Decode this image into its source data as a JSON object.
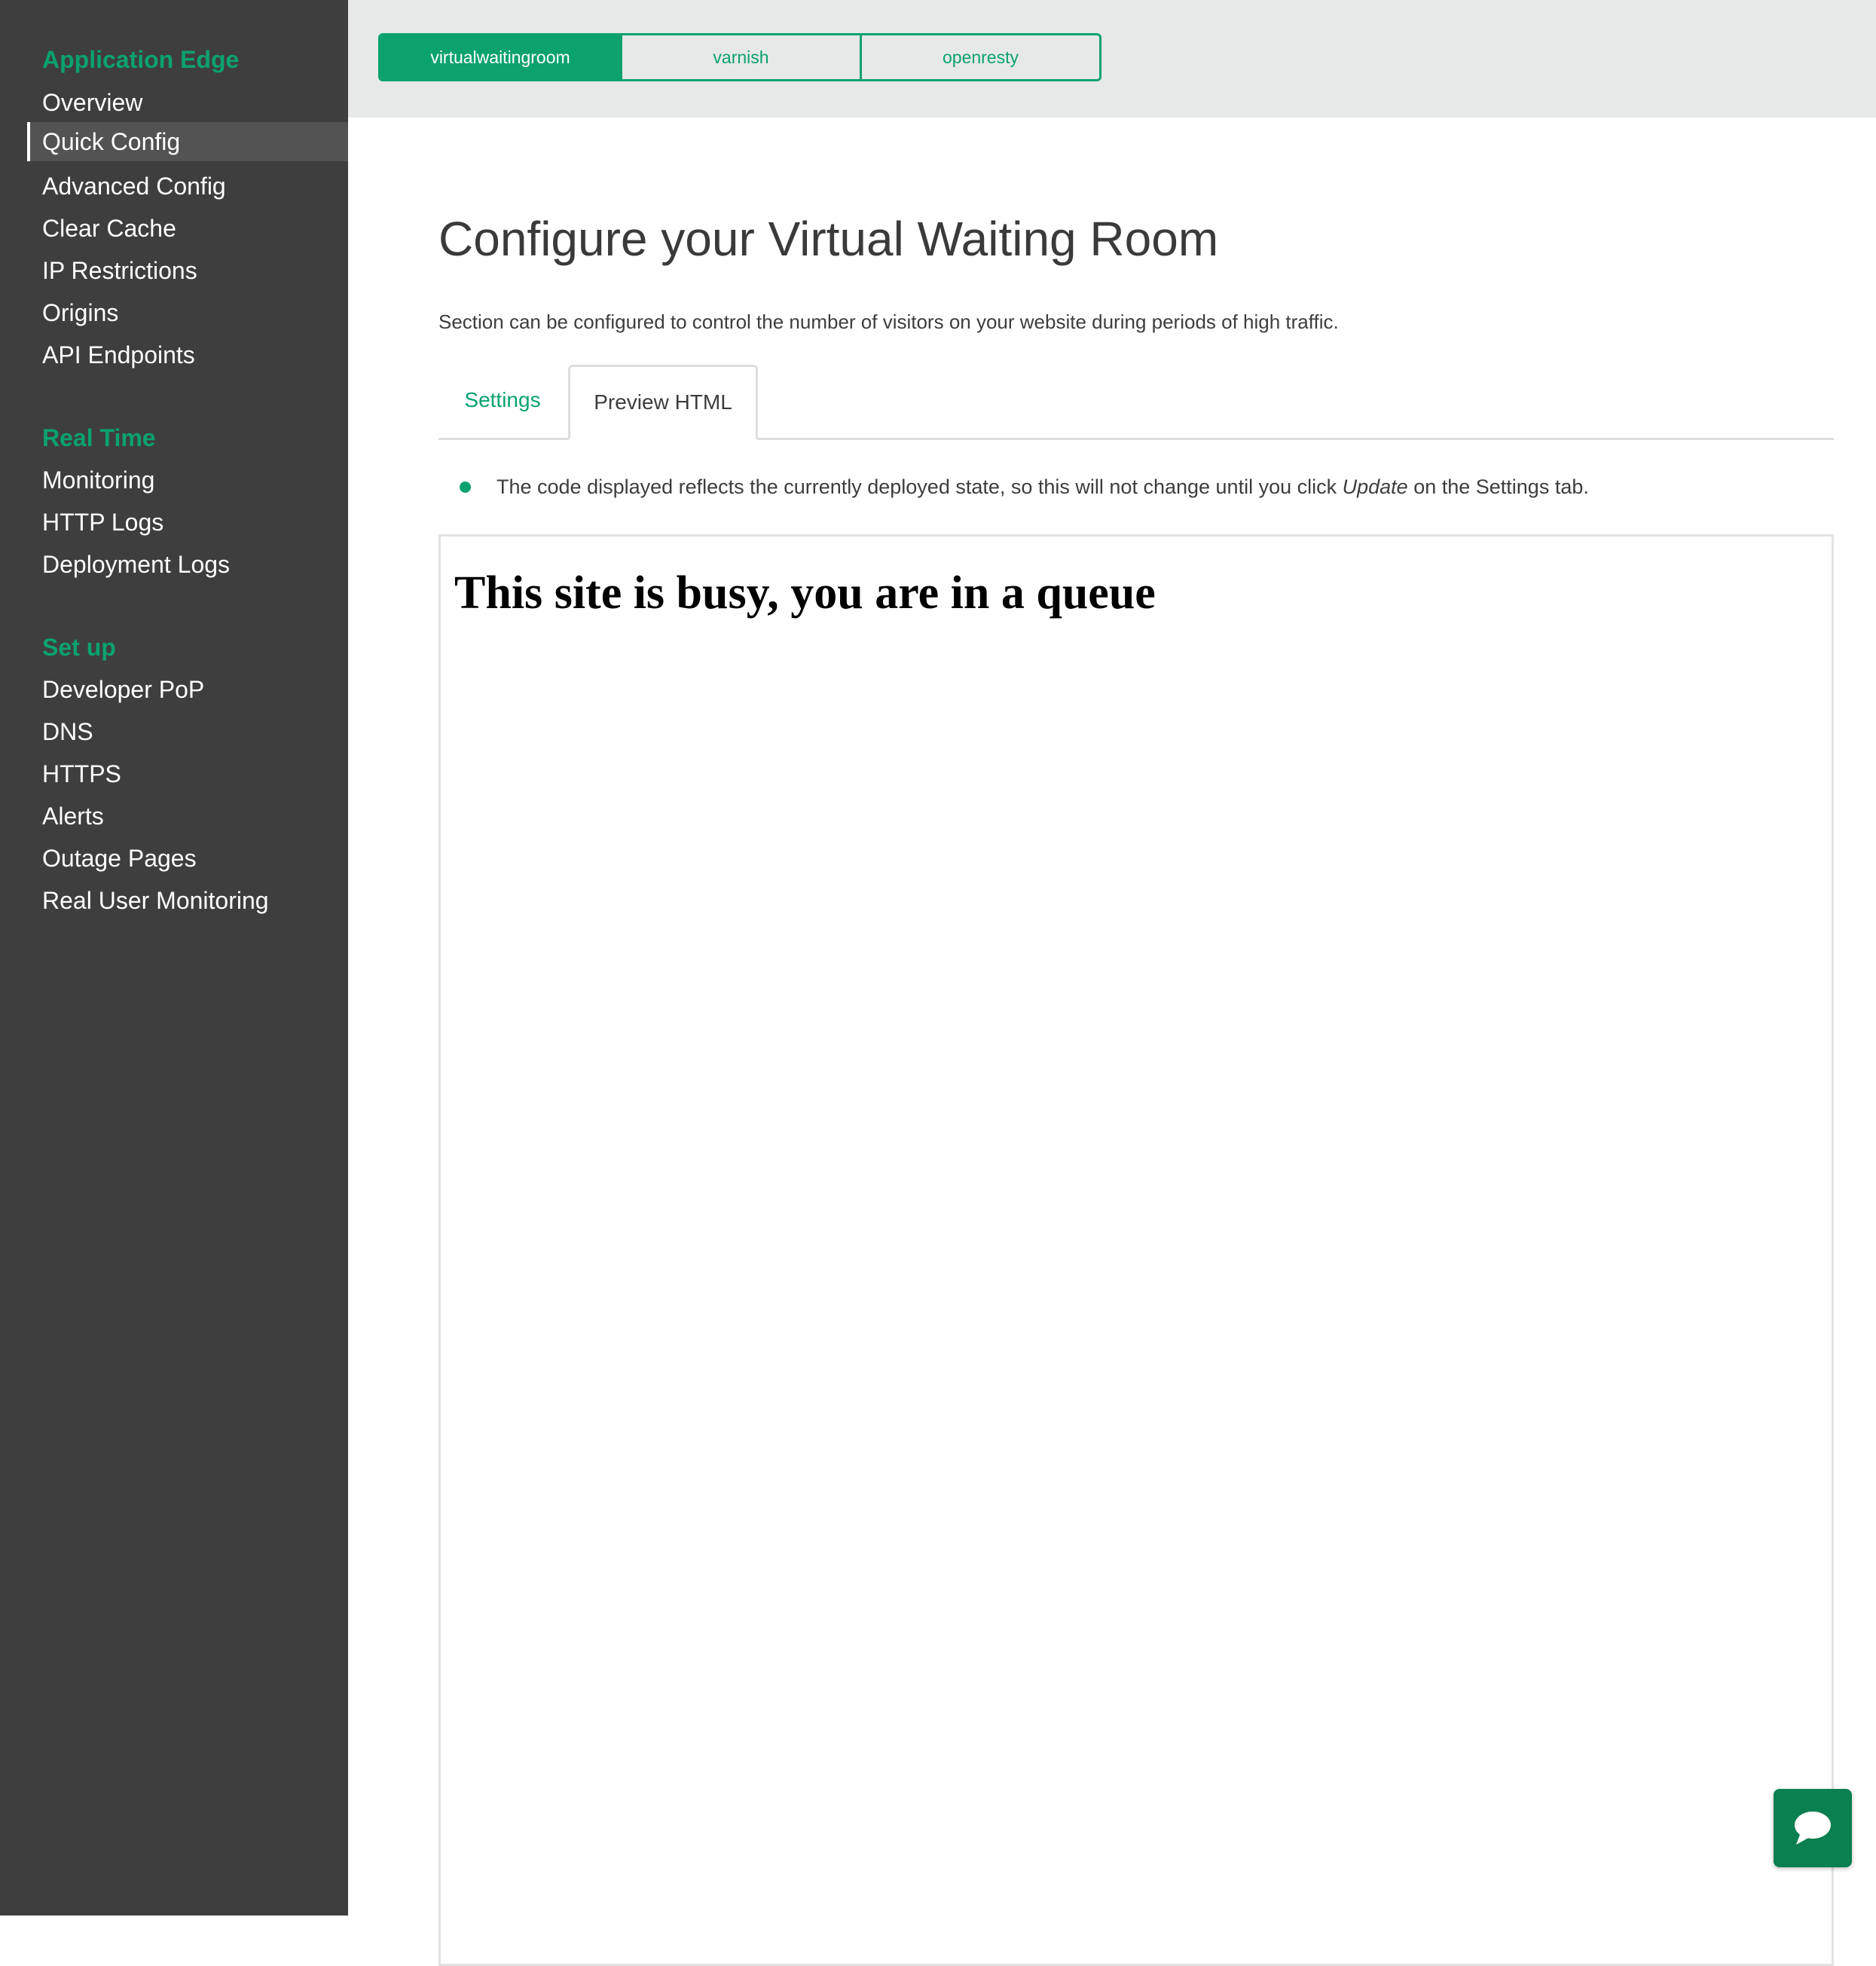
{
  "colors": {
    "accent": "#0ba26e",
    "sidebar_bg": "#3e3e3e",
    "topbar_bg": "#e7e9e8",
    "chat_bg": "#0a7f4f"
  },
  "sidebar": {
    "groups": [
      {
        "heading": "Application Edge",
        "items": [
          {
            "label": "Overview"
          },
          {
            "label": "Quick Config"
          },
          {
            "label": "Advanced Config"
          },
          {
            "label": "Clear Cache"
          },
          {
            "label": "IP Restrictions"
          },
          {
            "label": "Origins"
          },
          {
            "label": "API Endpoints"
          }
        ]
      },
      {
        "heading": "Real Time",
        "items": [
          {
            "label": "Monitoring"
          },
          {
            "label": "HTTP Logs"
          },
          {
            "label": "Deployment Logs"
          }
        ]
      },
      {
        "heading": "Set up",
        "items": [
          {
            "label": "Developer PoP"
          },
          {
            "label": "DNS"
          },
          {
            "label": "HTTPS"
          },
          {
            "label": "Alerts"
          },
          {
            "label": "Outage Pages"
          },
          {
            "label": "Real User Monitoring"
          }
        ]
      }
    ],
    "active_item": "Quick Config"
  },
  "topbar": {
    "segments": [
      {
        "label": "virtualwaitingroom"
      },
      {
        "label": "varnish"
      },
      {
        "label": "openresty"
      }
    ],
    "active_segment": "virtualwaitingroom"
  },
  "main": {
    "title": "Configure your Virtual Waiting Room",
    "description": "Section can be configured to control the number of visitors on your website during periods of high traffic.",
    "tabs": [
      {
        "label": "Settings"
      },
      {
        "label": "Preview HTML"
      }
    ],
    "active_tab": "Preview HTML",
    "notice": {
      "before": "The code displayed reflects the currently deployed state, so this will not change until you click ",
      "emphasis": "Update",
      "after": " on the Settings tab."
    },
    "preview": {
      "heading": "This site is busy, you are in a queue"
    }
  },
  "chat": {
    "icon": "chat-bubble-icon"
  }
}
